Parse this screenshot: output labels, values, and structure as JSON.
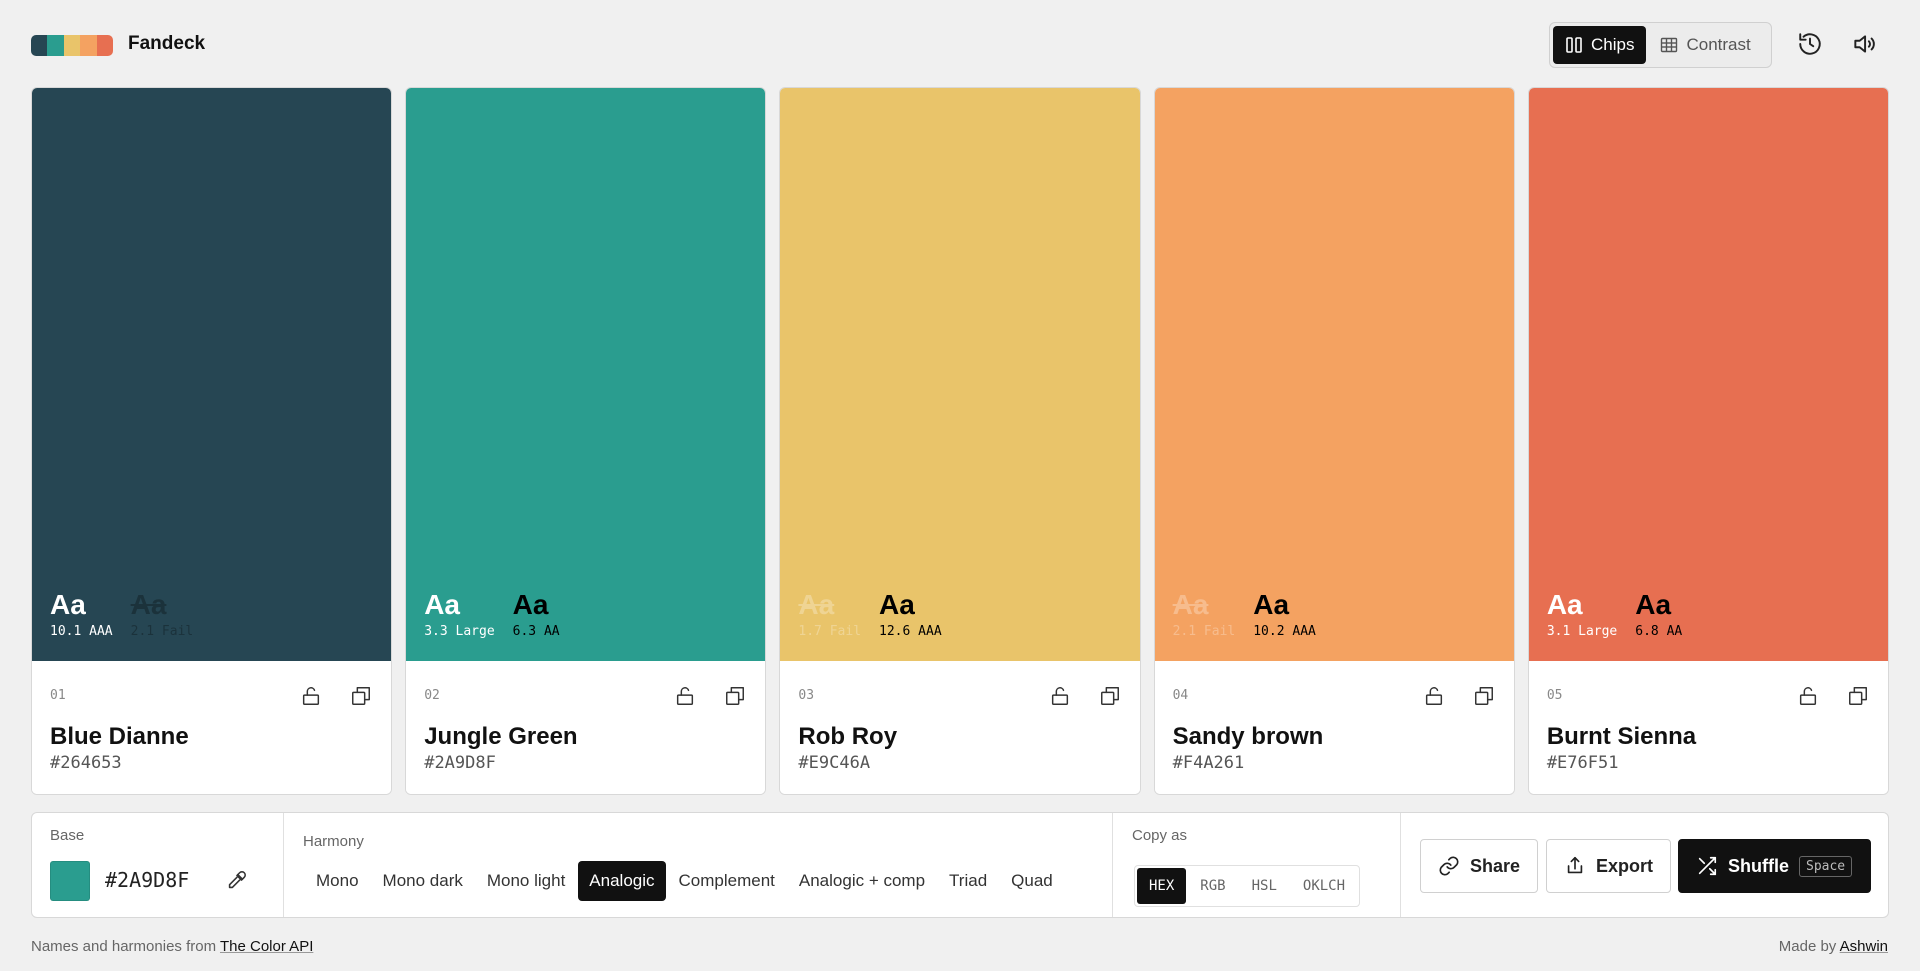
{
  "app": {
    "title": "Fandeck",
    "logo_colors": [
      "#264653",
      "#2A9D8F",
      "#E9C46A",
      "#F4A261",
      "#E76F51"
    ]
  },
  "header": {
    "view_tabs": [
      {
        "label": "Chips",
        "icon": "columns-icon",
        "active": true
      },
      {
        "label": "Contrast",
        "icon": "grid-icon",
        "active": false
      }
    ],
    "icons": [
      "history-icon",
      "speaker-icon"
    ]
  },
  "cards": [
    {
      "index": "01",
      "name": "Blue Dianne",
      "hex": "#264653",
      "color": "#264653",
      "contrast": [
        {
          "sample": "Aa",
          "score": "10.1 AAA",
          "text_color": "#ffffff",
          "fail": false
        },
        {
          "sample": "Aa",
          "score": "2.1 Fail",
          "text_color": "#000000",
          "fail": true
        }
      ]
    },
    {
      "index": "02",
      "name": "Jungle Green",
      "hex": "#2A9D8F",
      "color": "#2A9D8F",
      "contrast": [
        {
          "sample": "Aa",
          "score": "3.3 Large",
          "text_color": "#ffffff",
          "fail": false
        },
        {
          "sample": "Aa",
          "score": "6.3 AA",
          "text_color": "#000000",
          "fail": false
        }
      ]
    },
    {
      "index": "03",
      "name": "Rob Roy",
      "hex": "#E9C46A",
      "color": "#E9C46A",
      "contrast": [
        {
          "sample": "Aa",
          "score": "1.7 Fail",
          "text_color": "#ffffff",
          "fail": true
        },
        {
          "sample": "Aa",
          "score": "12.6 AAA",
          "text_color": "#000000",
          "fail": false
        }
      ]
    },
    {
      "index": "04",
      "name": "Sandy brown",
      "hex": "#F4A261",
      "color": "#F4A261",
      "contrast": [
        {
          "sample": "Aa",
          "score": "2.1 Fail",
          "text_color": "#ffffff",
          "fail": true
        },
        {
          "sample": "Aa",
          "score": "10.2 AAA",
          "text_color": "#000000",
          "fail": false
        }
      ]
    },
    {
      "index": "05",
      "name": "Burnt Sienna",
      "hex": "#E76F51",
      "color": "#E76F51",
      "contrast": [
        {
          "sample": "Aa",
          "score": "3.1 Large",
          "text_color": "#ffffff",
          "fail": false
        },
        {
          "sample": "Aa",
          "score": "6.8 AA",
          "text_color": "#000000",
          "fail": false
        }
      ]
    }
  ],
  "panel": {
    "base_label": "Base",
    "base_hex": "#2A9D8F",
    "base_color": "#2A9D8F",
    "harmony_label": "Harmony",
    "harmonies": [
      {
        "label": "Mono",
        "active": false
      },
      {
        "label": "Mono dark",
        "active": false
      },
      {
        "label": "Mono light",
        "active": false
      },
      {
        "label": "Analogic",
        "active": true
      },
      {
        "label": "Complement",
        "active": false
      },
      {
        "label": "Analogic + comp",
        "active": false
      },
      {
        "label": "Triad",
        "active": false
      },
      {
        "label": "Quad",
        "active": false
      }
    ],
    "copyas_label": "Copy as",
    "formats": [
      {
        "label": "HEX",
        "active": true
      },
      {
        "label": "RGB",
        "active": false
      },
      {
        "label": "HSL",
        "active": false
      },
      {
        "label": "OKLCH",
        "active": false
      }
    ],
    "share_label": "Share",
    "export_label": "Export",
    "shuffle_label": "Shuffle",
    "shuffle_key": "Space"
  },
  "footer": {
    "left_prefix": "Names and harmonies from ",
    "left_link": "The Color API",
    "right_prefix": "Made by ",
    "right_link": "Ashwin"
  }
}
